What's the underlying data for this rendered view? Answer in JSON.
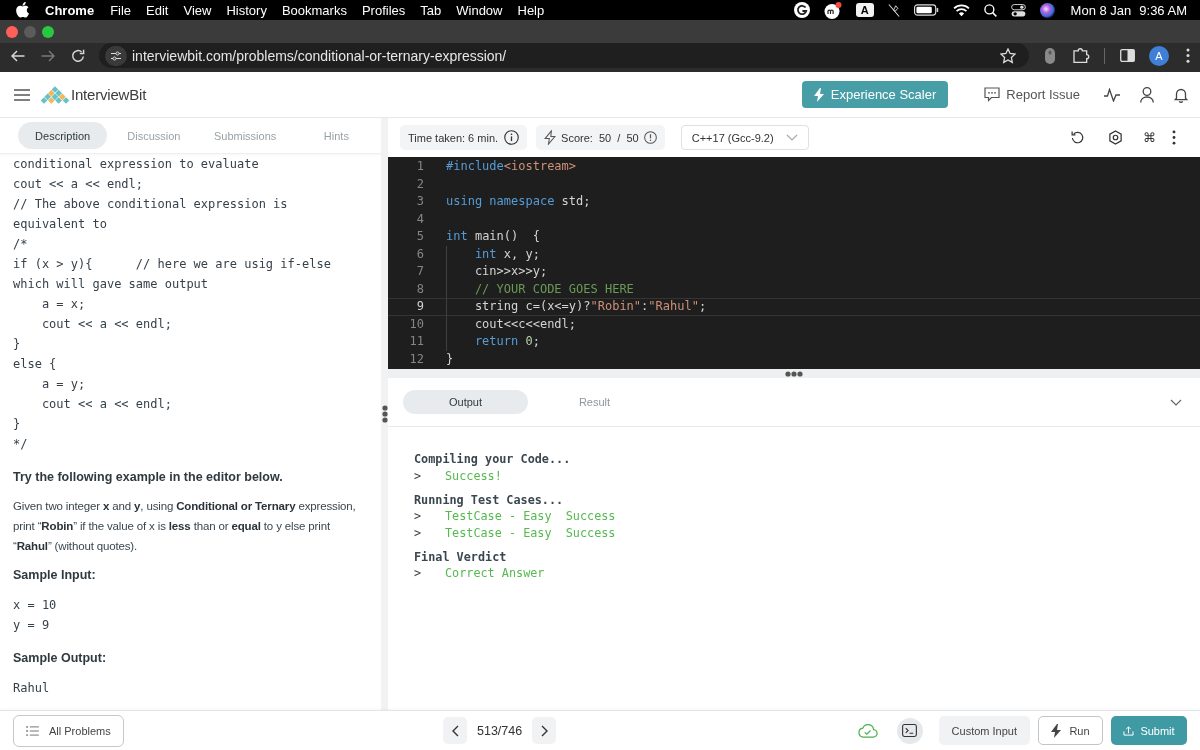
{
  "menu_bar": {
    "app": "Chrome",
    "items": [
      "File",
      "Edit",
      "View",
      "History",
      "Bookmarks",
      "Profiles",
      "Tab",
      "Window",
      "Help"
    ],
    "input_source": "A",
    "date": "Mon 8 Jan",
    "time": "9:36 AM"
  },
  "window_controls": [
    {
      "kind": "close",
      "disabled": false
    },
    {
      "kind": "minimize",
      "disabled": true
    },
    {
      "kind": "zoom",
      "disabled": false
    }
  ],
  "browser": {
    "nav": [
      {
        "kind": "back",
        "disabled": false
      },
      {
        "kind": "forward",
        "disabled": true
      },
      {
        "kind": "reload",
        "disabled": false
      }
    ],
    "url": "interviewbit.com/problems/conditional-or-ternary-expression/",
    "profile_initial": "A"
  },
  "header": {
    "logo_text": "InterviewBit",
    "cta": "Experience Scaler",
    "report": "Report Issue"
  },
  "left_tabs": [
    {
      "label": "Description",
      "selected": true
    },
    {
      "label": "Discussion",
      "selected": false
    },
    {
      "label": "Submissions",
      "selected": false
    },
    {
      "label": "Hints",
      "selected": false
    }
  ],
  "description": {
    "code": [
      "conditional expression to evaluate",
      "cout << a << endl;",
      "// The above conditional expression is",
      "equivalent to",
      "/*",
      "if (x > y){      // here we are usig if-else",
      "which will gave same output",
      "    a = x;",
      "    cout << a << endl;",
      "}",
      "else {",
      "    a = y;",
      "    cout << a << endl;",
      "}",
      "*/"
    ],
    "heading": "Try the following example in the editor below.",
    "paragraph": "Given two integer **x** and **y**, using **Conditional or Ternary** expression, print “**Robin**” if the value of x is **less** than or **equal** to y else print “**Rahul**” (without quotes).",
    "sample_input_label": "Sample Input:",
    "sample_input": [
      "x = 10",
      "y = 9"
    ],
    "sample_output_label": "Sample Output:",
    "sample_output": "Rahul"
  },
  "editor_toolbar": {
    "time_taken": "Time taken: 6 min.",
    "score": "Score:  50  /  50",
    "language": "C++17 (Gcc-9.2)",
    "shortcut_glyph": "⌘"
  },
  "code": [
    {
      "number": "1",
      "current": false,
      "tokens": [
        {
          "kind": "keyword",
          "text": "#include"
        },
        {
          "kind": "string",
          "text": "<iostream>"
        }
      ]
    },
    {
      "number": "2",
      "current": false
    },
    {
      "number": "3",
      "current": false,
      "tokens": [
        {
          "kind": "keyword",
          "text": "using namespace"
        },
        {
          "kind": "plain",
          "text": " std;"
        }
      ]
    },
    {
      "number": "4",
      "current": false
    },
    {
      "number": "5",
      "current": false,
      "tokens": [
        {
          "kind": "keyword",
          "text": "int"
        },
        {
          "kind": "plain",
          "text": " main()  {"
        }
      ]
    },
    {
      "number": "6",
      "current": false,
      "tokens": [
        {
          "kind": "keyword",
          "text": "    int"
        },
        {
          "kind": "plain",
          "text": " x, y;"
        }
      ]
    },
    {
      "number": "7",
      "current": false,
      "tokens": [
        {
          "kind": "plain",
          "text": "    cin>>x>>y;"
        }
      ]
    },
    {
      "number": "8",
      "current": false,
      "tokens": [
        {
          "kind": "comment",
          "text": "    // YOUR CODE GOES HERE"
        }
      ]
    },
    {
      "number": "9",
      "current": true,
      "tokens": [
        {
          "kind": "plain",
          "text": "    string c=(x<=y)?"
        },
        {
          "kind": "string",
          "text": "\"Robin\""
        },
        {
          "kind": "plain",
          "text": ":"
        },
        {
          "kind": "string",
          "text": "\"Rahul\""
        },
        {
          "kind": "plain",
          "text": ";"
        }
      ]
    },
    {
      "number": "10",
      "current": false,
      "tokens": [
        {
          "kind": "plain",
          "text": "    cout<<c<<endl;"
        }
      ]
    },
    {
      "number": "11",
      "current": false,
      "tokens": [
        {
          "kind": "keyword",
          "text": "    return"
        },
        {
          "kind": "number",
          "text": " 0"
        },
        {
          "kind": "plain",
          "text": ";"
        }
      ]
    },
    {
      "number": "12",
      "current": false,
      "tokens": [
        {
          "kind": "plain",
          "text": "}"
        }
      ]
    }
  ],
  "output_tabs": [
    {
      "label": "Output",
      "selected": true
    },
    {
      "label": "Result",
      "selected": false
    }
  ],
  "console": [
    {
      "heading": "Compiling your Code...",
      "results": [
        {
          "prompt": ">",
          "text": "Success!"
        }
      ]
    },
    {
      "heading": "Running Test Cases...",
      "results": [
        {
          "prompt": ">",
          "text": "TestCase - Easy  Success"
        },
        {
          "prompt": ">",
          "text": "TestCase - Easy  Success"
        }
      ]
    },
    {
      "heading": "Final Verdict",
      "results": [
        {
          "prompt": ">",
          "text": "Correct Answer"
        }
      ]
    }
  ],
  "footer": {
    "all_problems": "All Problems",
    "page": "513/746",
    "custom_input": "Custom Input",
    "run": "Run",
    "submit": "Submit"
  }
}
